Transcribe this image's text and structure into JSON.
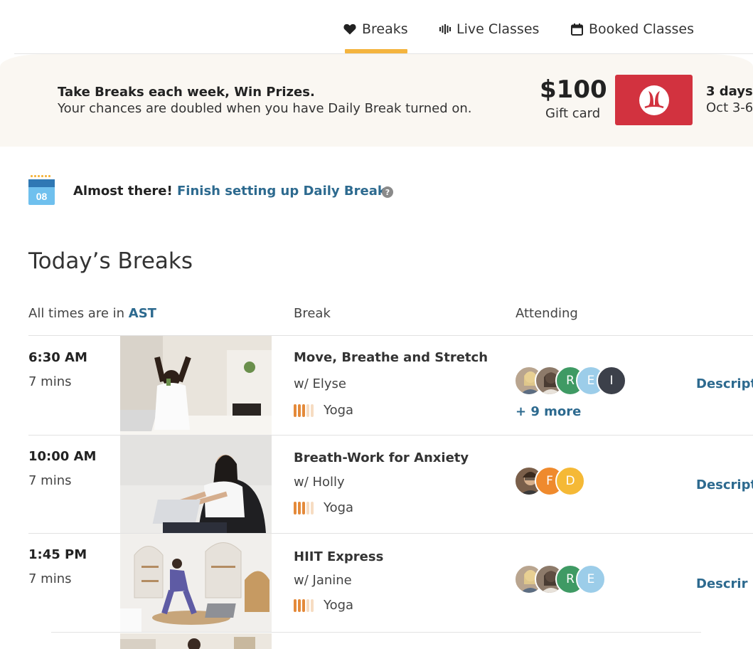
{
  "tabs": [
    {
      "label": "Breaks",
      "icon": "heart-icon",
      "active": true
    },
    {
      "label": "Live Classes",
      "icon": "live-bars-icon",
      "active": false
    },
    {
      "label": "Booked Classes",
      "icon": "calendar-icon",
      "active": false
    }
  ],
  "colors": {
    "accent": "#f4b43e",
    "link": "#2d6a8f",
    "brand_red": "#d2323f",
    "banner_bg": "#faf7f2"
  },
  "banner": {
    "title": "Take Breaks each week, Win Prizes.",
    "subtitle": "Your chances are doubled when you have Daily Break turned on.",
    "prize_amount": "$100",
    "prize_label": "Gift card",
    "brand_logo": "lululemon-logo",
    "days_label": "3 days",
    "date_range": "Oct 3-6"
  },
  "setup": {
    "calendar_day": "08",
    "almost_text": "Almost there!",
    "finish_link": "Finish setting up Daily Break",
    "help_icon": "?"
  },
  "page_title": "Today’s Breaks",
  "columns": {
    "times_prefix": "All times are in",
    "timezone": "AST",
    "break": "Break",
    "attending": "Attending"
  },
  "breaks": [
    {
      "time": "6:30 AM",
      "duration": "7 mins",
      "title": "Move, Breathe and Stretch",
      "instructor": "w/ Elyse",
      "type": "Yoga",
      "level": 3,
      "level_max": 5,
      "attendees": [
        {
          "initial": "",
          "color": "#b9a58f",
          "photo": true
        },
        {
          "initial": "",
          "color": "#8d7a6a",
          "photo": true
        },
        {
          "initial": "R",
          "color": "#3f9a64",
          "photo": false
        },
        {
          "initial": "E",
          "color": "#9ccde9",
          "photo": false
        },
        {
          "initial": "I",
          "color": "#3c404a",
          "photo": false
        }
      ],
      "more": "+ 9 more",
      "link": "Descript"
    },
    {
      "time": "10:00 AM",
      "duration": "7 mins",
      "title": "Breath-Work for Anxiety",
      "instructor": "w/ Holly",
      "type": "Yoga",
      "level": 3,
      "level_max": 5,
      "attendees": [
        {
          "initial": "",
          "color": "#7a5f4a",
          "photo": true
        },
        {
          "initial": "F",
          "color": "#ef8a2d",
          "photo": false
        },
        {
          "initial": "D",
          "color": "#f5b936",
          "photo": false
        }
      ],
      "more": "",
      "link": "Descript"
    },
    {
      "time": "1:45 PM",
      "duration": "7 mins",
      "title": "HIIT Express",
      "instructor": "w/ Janine",
      "type": "Yoga",
      "level": 3,
      "level_max": 5,
      "attendees": [
        {
          "initial": "",
          "color": "#b9a58f",
          "photo": true
        },
        {
          "initial": "",
          "color": "#8d7a6a",
          "photo": true
        },
        {
          "initial": "R",
          "color": "#3f9a64",
          "photo": false
        },
        {
          "initial": "E",
          "color": "#9ccde9",
          "photo": false
        }
      ],
      "more": "",
      "link": "Descrir"
    }
  ]
}
